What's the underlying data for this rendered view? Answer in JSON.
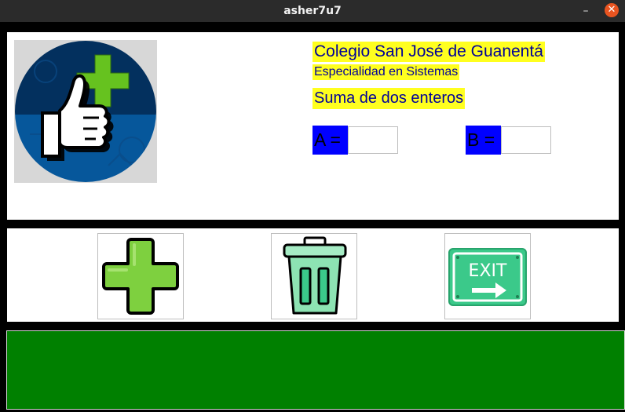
{
  "window": {
    "title": "asher7u7",
    "minimize_label": "–",
    "close_label": "✕"
  },
  "header": {
    "school": "Colegio San José de Guanentá",
    "specialty": "Especialidad en Sistemas",
    "subtitle": "Suma de dos enteros"
  },
  "form": {
    "a_label": "A =",
    "a_value": "",
    "b_label": "B =",
    "b_value": ""
  },
  "buttons": {
    "add_icon": "plus-icon",
    "delete_icon": "trash-icon",
    "exit_icon": "exit-sign-icon",
    "exit_text": "EXIT"
  },
  "colors": {
    "title_bar": "#2b2b2b",
    "close_button": "#e95420",
    "highlight": "#ffff1f",
    "label_text": "#000099",
    "input_label_bg": "#0000ff",
    "result_panel": "#008000",
    "plus_green": "#7ed03f",
    "exit_green": "#3bc98a"
  }
}
